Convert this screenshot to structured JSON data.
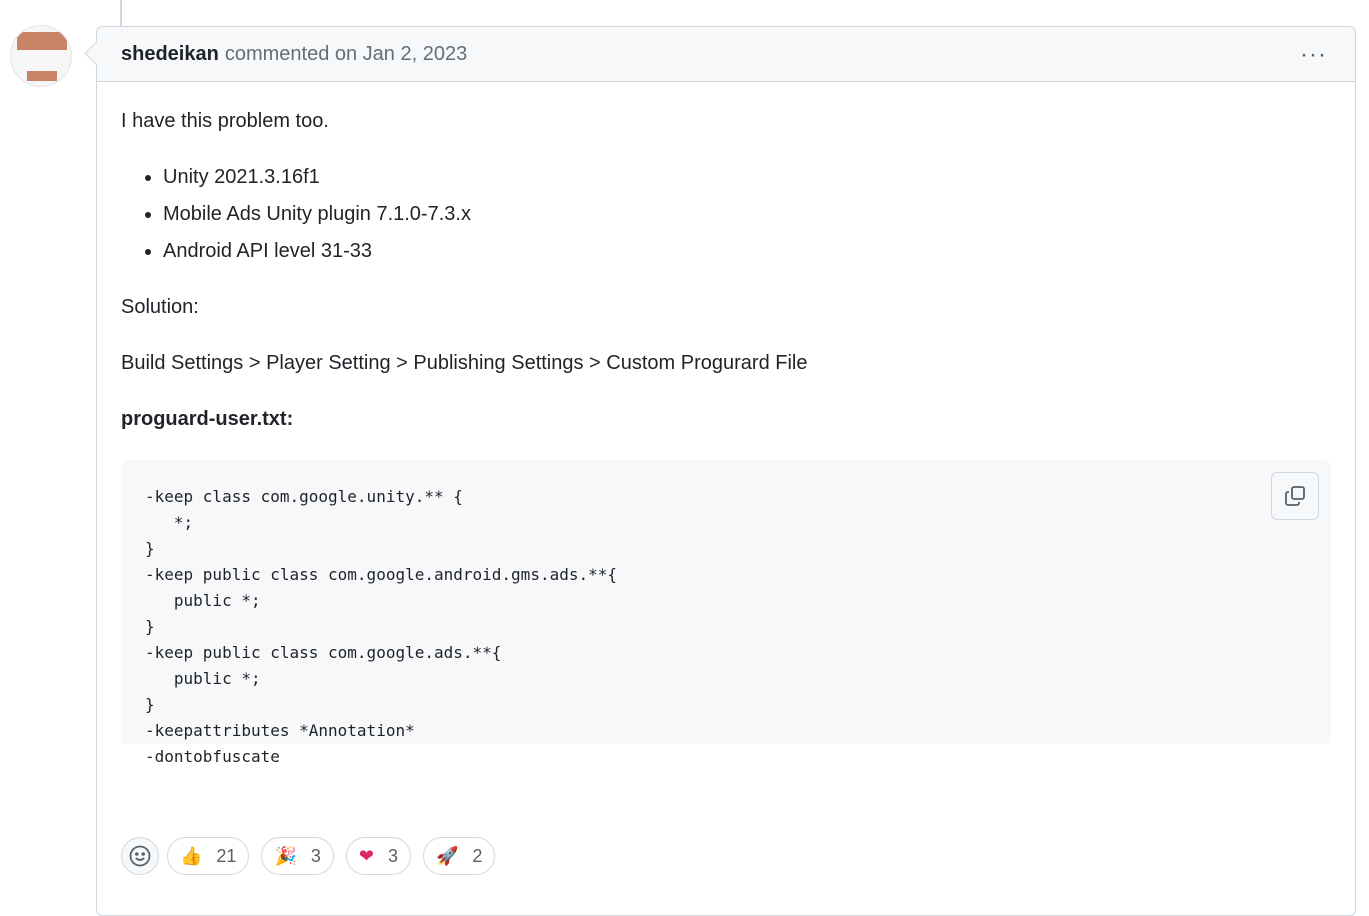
{
  "comment": {
    "author": "shedeikan",
    "meta": "commented on Jan 2, 2023",
    "menu_icon": "kebab-horizontal-icon",
    "menu_label": "···"
  },
  "body": {
    "intro": "I have this problem too.",
    "env_items": [
      "Unity 2021.3.16f1",
      "Mobile Ads Unity plugin 7.1.0-7.3.x",
      "Android API level 31-33"
    ],
    "solution_label": "Solution:",
    "path": "Build Settings > Player Setting > Publishing Settings > Custom Progurard File",
    "file_name": "proguard-user.txt:",
    "code": "-keep class com.google.unity.** {\n   *;\n}\n-keep public class com.google.android.gms.ads.**{\n   public *;\n}\n-keep public class com.google.ads.**{\n   public *;\n}\n-keepattributes *Annotation*\n-dontobfuscate",
    "copy_icon": "copy-icon"
  },
  "reactions": [
    {
      "icon": "thumbs-up-icon",
      "emoji": "👍",
      "count": "21"
    },
    {
      "icon": "tada-icon",
      "emoji": "🎉",
      "count": "3"
    },
    {
      "icon": "heart-icon",
      "emoji": "❤",
      "count": "3"
    },
    {
      "icon": "rocket-icon",
      "emoji": "🚀",
      "count": "2"
    }
  ],
  "colors": {
    "border": "#d0d7de",
    "header_bg": "#f6f8fa",
    "muted": "#656d76",
    "heart": "#e0245e"
  }
}
